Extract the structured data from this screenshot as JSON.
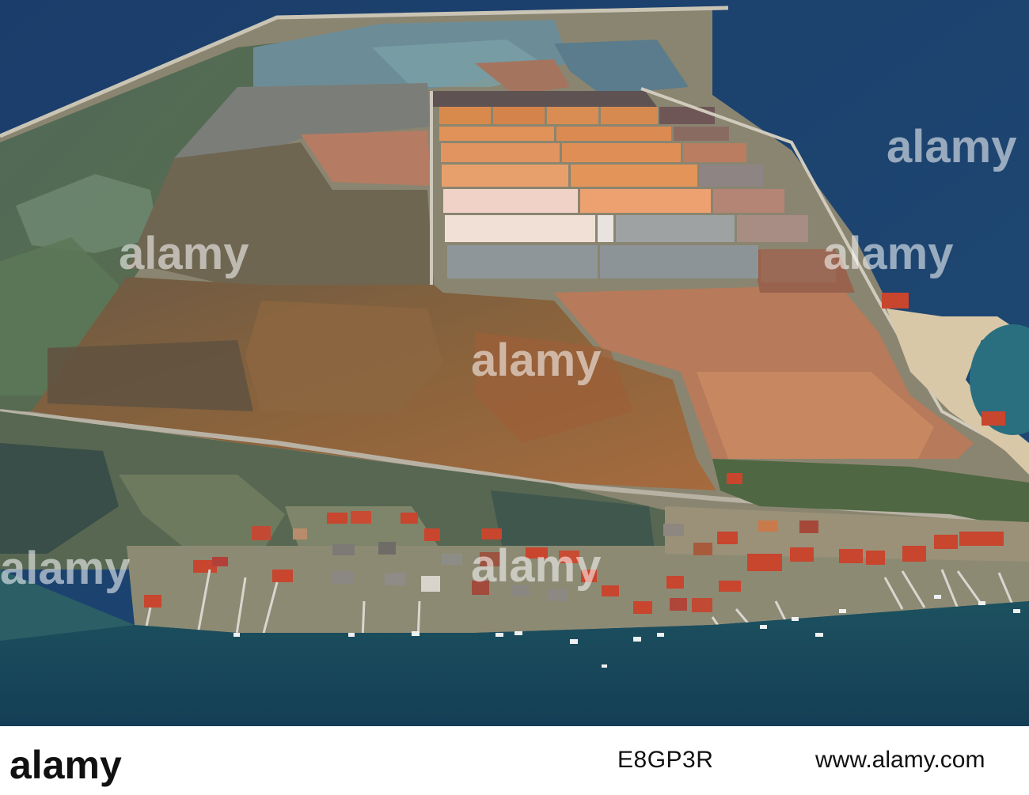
{
  "photo": {
    "description_kind": "aerial-photograph",
    "colors": {
      "open_sea": "#1c3f6e",
      "lagoon_water": "#3d5f6a",
      "salt_pan_orange": "#d88a4c",
      "salt_pan_white": "#f1e0d6",
      "salt_pan_grey": "#8e969a",
      "mudflat_brown": "#7b5a3b",
      "roof_red": "#c8452e"
    }
  },
  "watermarks": {
    "left": "alamy",
    "center": "alamy",
    "right": "alamy",
    "bottom_left": "alamy",
    "bottom_center": "alamy",
    "bottom_right": "alamy"
  },
  "footer": {
    "logo_text": "alamy",
    "image_id": "E8GP3R",
    "url": "www.alamy.com"
  }
}
